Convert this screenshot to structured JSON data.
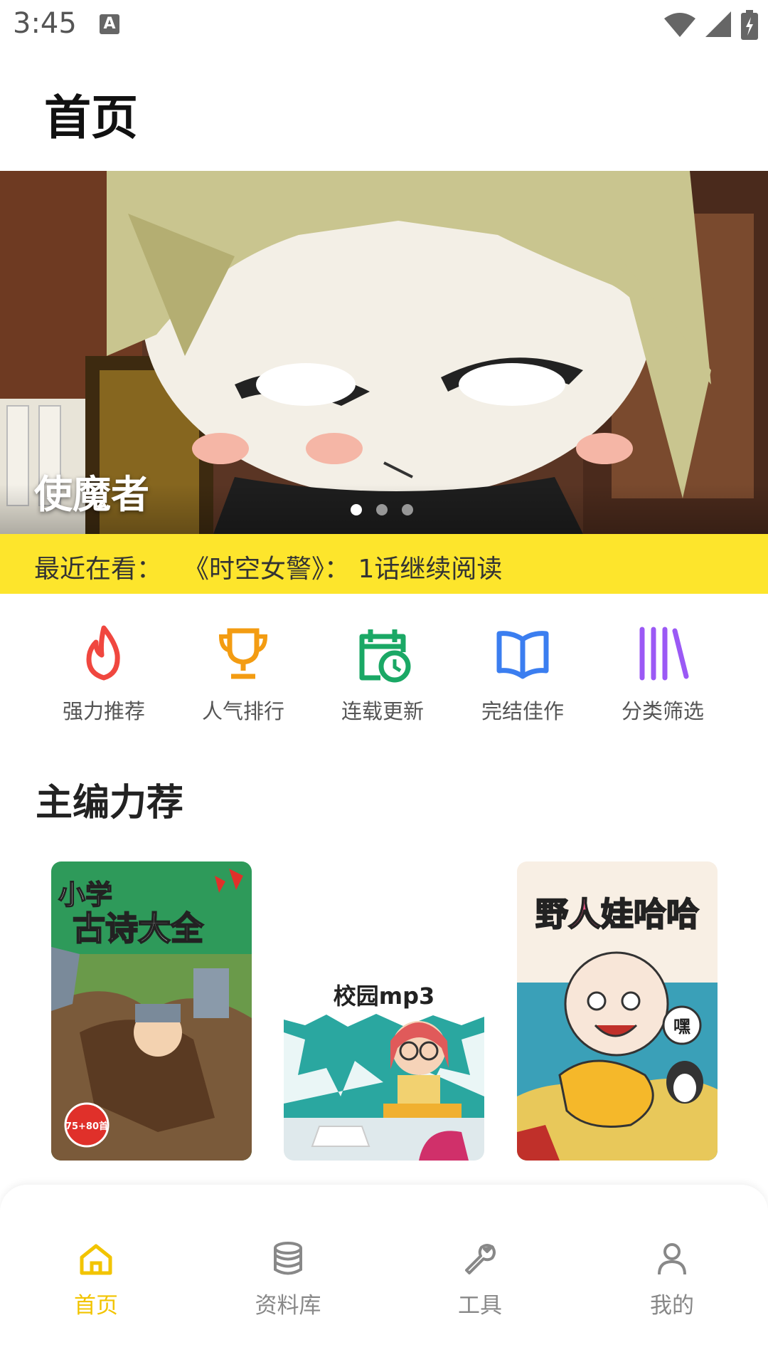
{
  "status_bar": {
    "time": "3:45",
    "a_icon": "A"
  },
  "header": {
    "title": "首页"
  },
  "banner": {
    "title": "使魔者",
    "dot_count": 3,
    "active_dot": 0
  },
  "recent": {
    "label": "最近在看：",
    "text": "《时空女警》： 1话继续阅读"
  },
  "categories": [
    {
      "label": "强力推荐",
      "icon": "flame-icon",
      "color": "#f0473f"
    },
    {
      "label": "人气排行",
      "icon": "trophy-icon",
      "color": "#f39c12"
    },
    {
      "label": "连载更新",
      "icon": "calendar-clock-icon",
      "color": "#1aa865"
    },
    {
      "label": "完结佳作",
      "icon": "book-icon",
      "color": "#3b7ef0"
    },
    {
      "label": "分类筛选",
      "icon": "library-icon",
      "color": "#9b59f5"
    }
  ],
  "section": {
    "title": "主编力荐"
  },
  "books": [
    {
      "cover_line1": "小学",
      "cover_line2": "古诗大全",
      "badge": "75+80首"
    },
    {
      "cover_title": "校园mp3"
    },
    {
      "cover_title": "野人娃哈哈",
      "badge": "嘿"
    }
  ],
  "bottom_nav": [
    {
      "label": "首页",
      "icon": "home-icon",
      "active": true
    },
    {
      "label": "资料库",
      "icon": "database-icon",
      "active": false
    },
    {
      "label": "工具",
      "icon": "wrench-icon",
      "active": false
    },
    {
      "label": "我的",
      "icon": "user-icon",
      "active": false
    }
  ],
  "colors": {
    "accent": "#fde52c",
    "nav_active": "#f2c400",
    "nav_inactive": "#888888"
  }
}
